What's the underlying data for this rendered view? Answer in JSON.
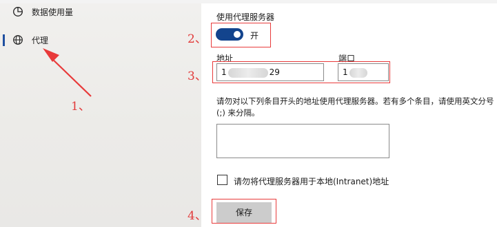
{
  "sidebar": {
    "items": [
      {
        "label": "数据使用量",
        "icon": "data-usage-icon"
      },
      {
        "label": "代理",
        "icon": "globe-icon",
        "active": true
      }
    ]
  },
  "proxy": {
    "section_title": "使用代理服务器",
    "toggle_state": "开",
    "toggle_on": true,
    "address_label": "地址",
    "address_value_start": "1",
    "address_value_end": "29",
    "port_label": "端口",
    "port_value": "1",
    "exceptions_description": "请勿对以下列条目开头的地址使用代理服务器。若有多个条目，请使用英文分号 (;) 来分隔。",
    "exceptions_value": "",
    "bypass_local_label": "请勿将代理服务器用于本地(Intranet)地址",
    "bypass_local_checked": false,
    "save_label": "保存"
  },
  "annotations": {
    "step1": "1、",
    "step2": "2、",
    "step3": "3、",
    "step4": "4、"
  },
  "colors": {
    "accent": "#13448d",
    "annotation": "#e23b3b"
  }
}
